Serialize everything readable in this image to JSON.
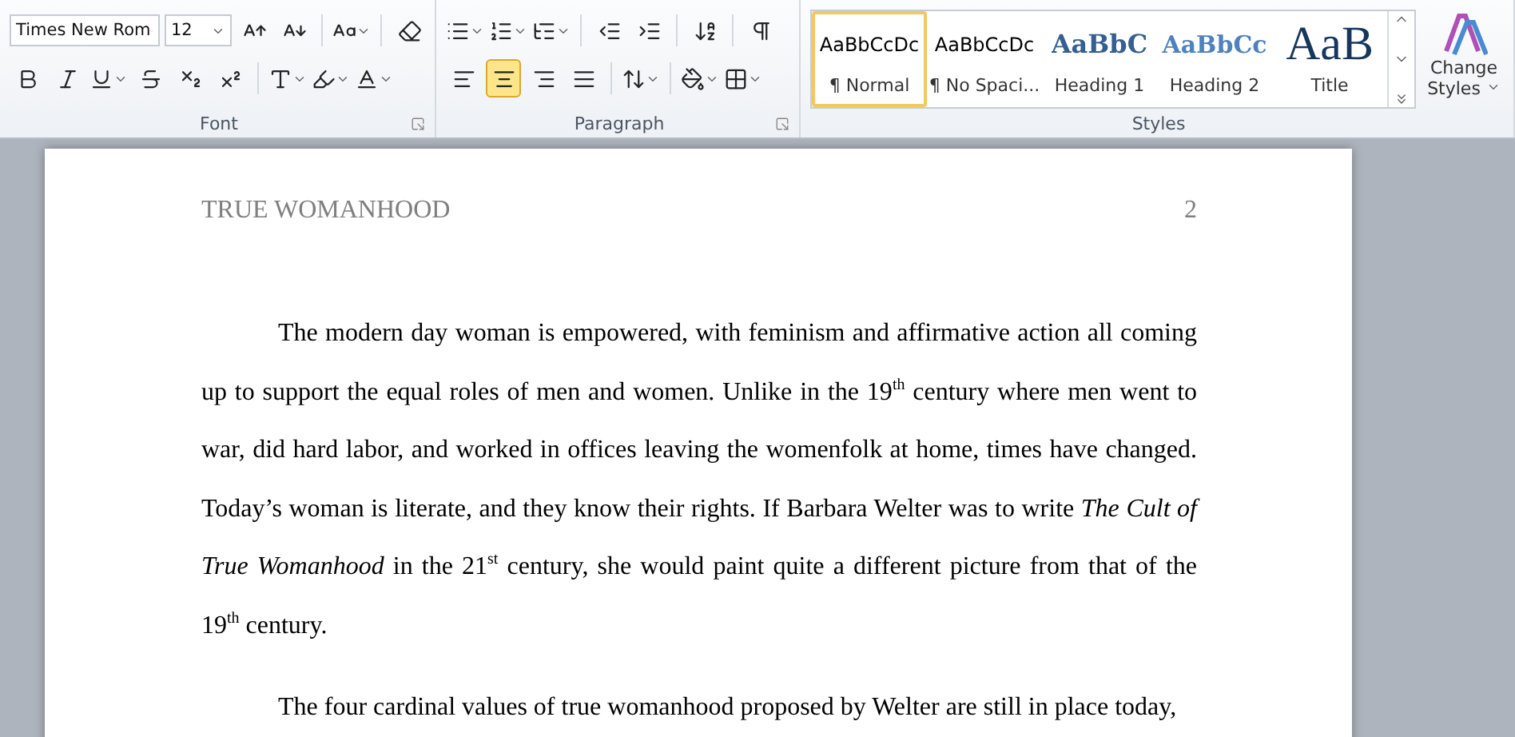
{
  "ribbon": {
    "font": {
      "name": "Times New Rom",
      "size": "12",
      "label": "Font"
    },
    "paragraph": {
      "label": "Paragraph",
      "alignment": [
        {
          "kind": "left",
          "selected": false
        },
        {
          "kind": "center",
          "selected": true
        },
        {
          "kind": "right",
          "selected": false
        },
        {
          "kind": "justify",
          "selected": false
        }
      ]
    },
    "styles": {
      "label": "Styles",
      "items": [
        {
          "kind": "normal",
          "preview": "AaBbCcDc",
          "label": "¶ Normal",
          "selected": true
        },
        {
          "kind": "plain",
          "preview": "AaBbCcDc",
          "label": "¶ No Spaci...",
          "selected": false
        },
        {
          "kind": "heading1",
          "preview": "AaBbC",
          "label": "Heading 1",
          "selected": false
        },
        {
          "kind": "heading2",
          "preview": "AaBbCc",
          "label": "Heading 2",
          "selected": false
        },
        {
          "kind": "title",
          "preview": "AaB",
          "label": "Title",
          "selected": false
        }
      ],
      "change_styles": "Change Styles"
    }
  },
  "document": {
    "header": "TRUE WOMANHOOD",
    "page_number": "2",
    "paragraphs": [
      "The modern day woman is empowered, with feminism and affirmative action all coming up to support the equal roles of men and women. Unlike in the 19$^{th}$ century where men went to war, did hard labor, and worked in offices leaving the womenfolk at home, times have changed. Today’s woman is literate, and they know their rights. If Barbara Welter was to write *The Cult of True Womanhood* in the 21$^{st}$ century, she would paint quite a different picture from that of the 19$^{th}$ century.",
      "The four cardinal values of true womanhood proposed by Welter are still in place today,"
    ]
  }
}
